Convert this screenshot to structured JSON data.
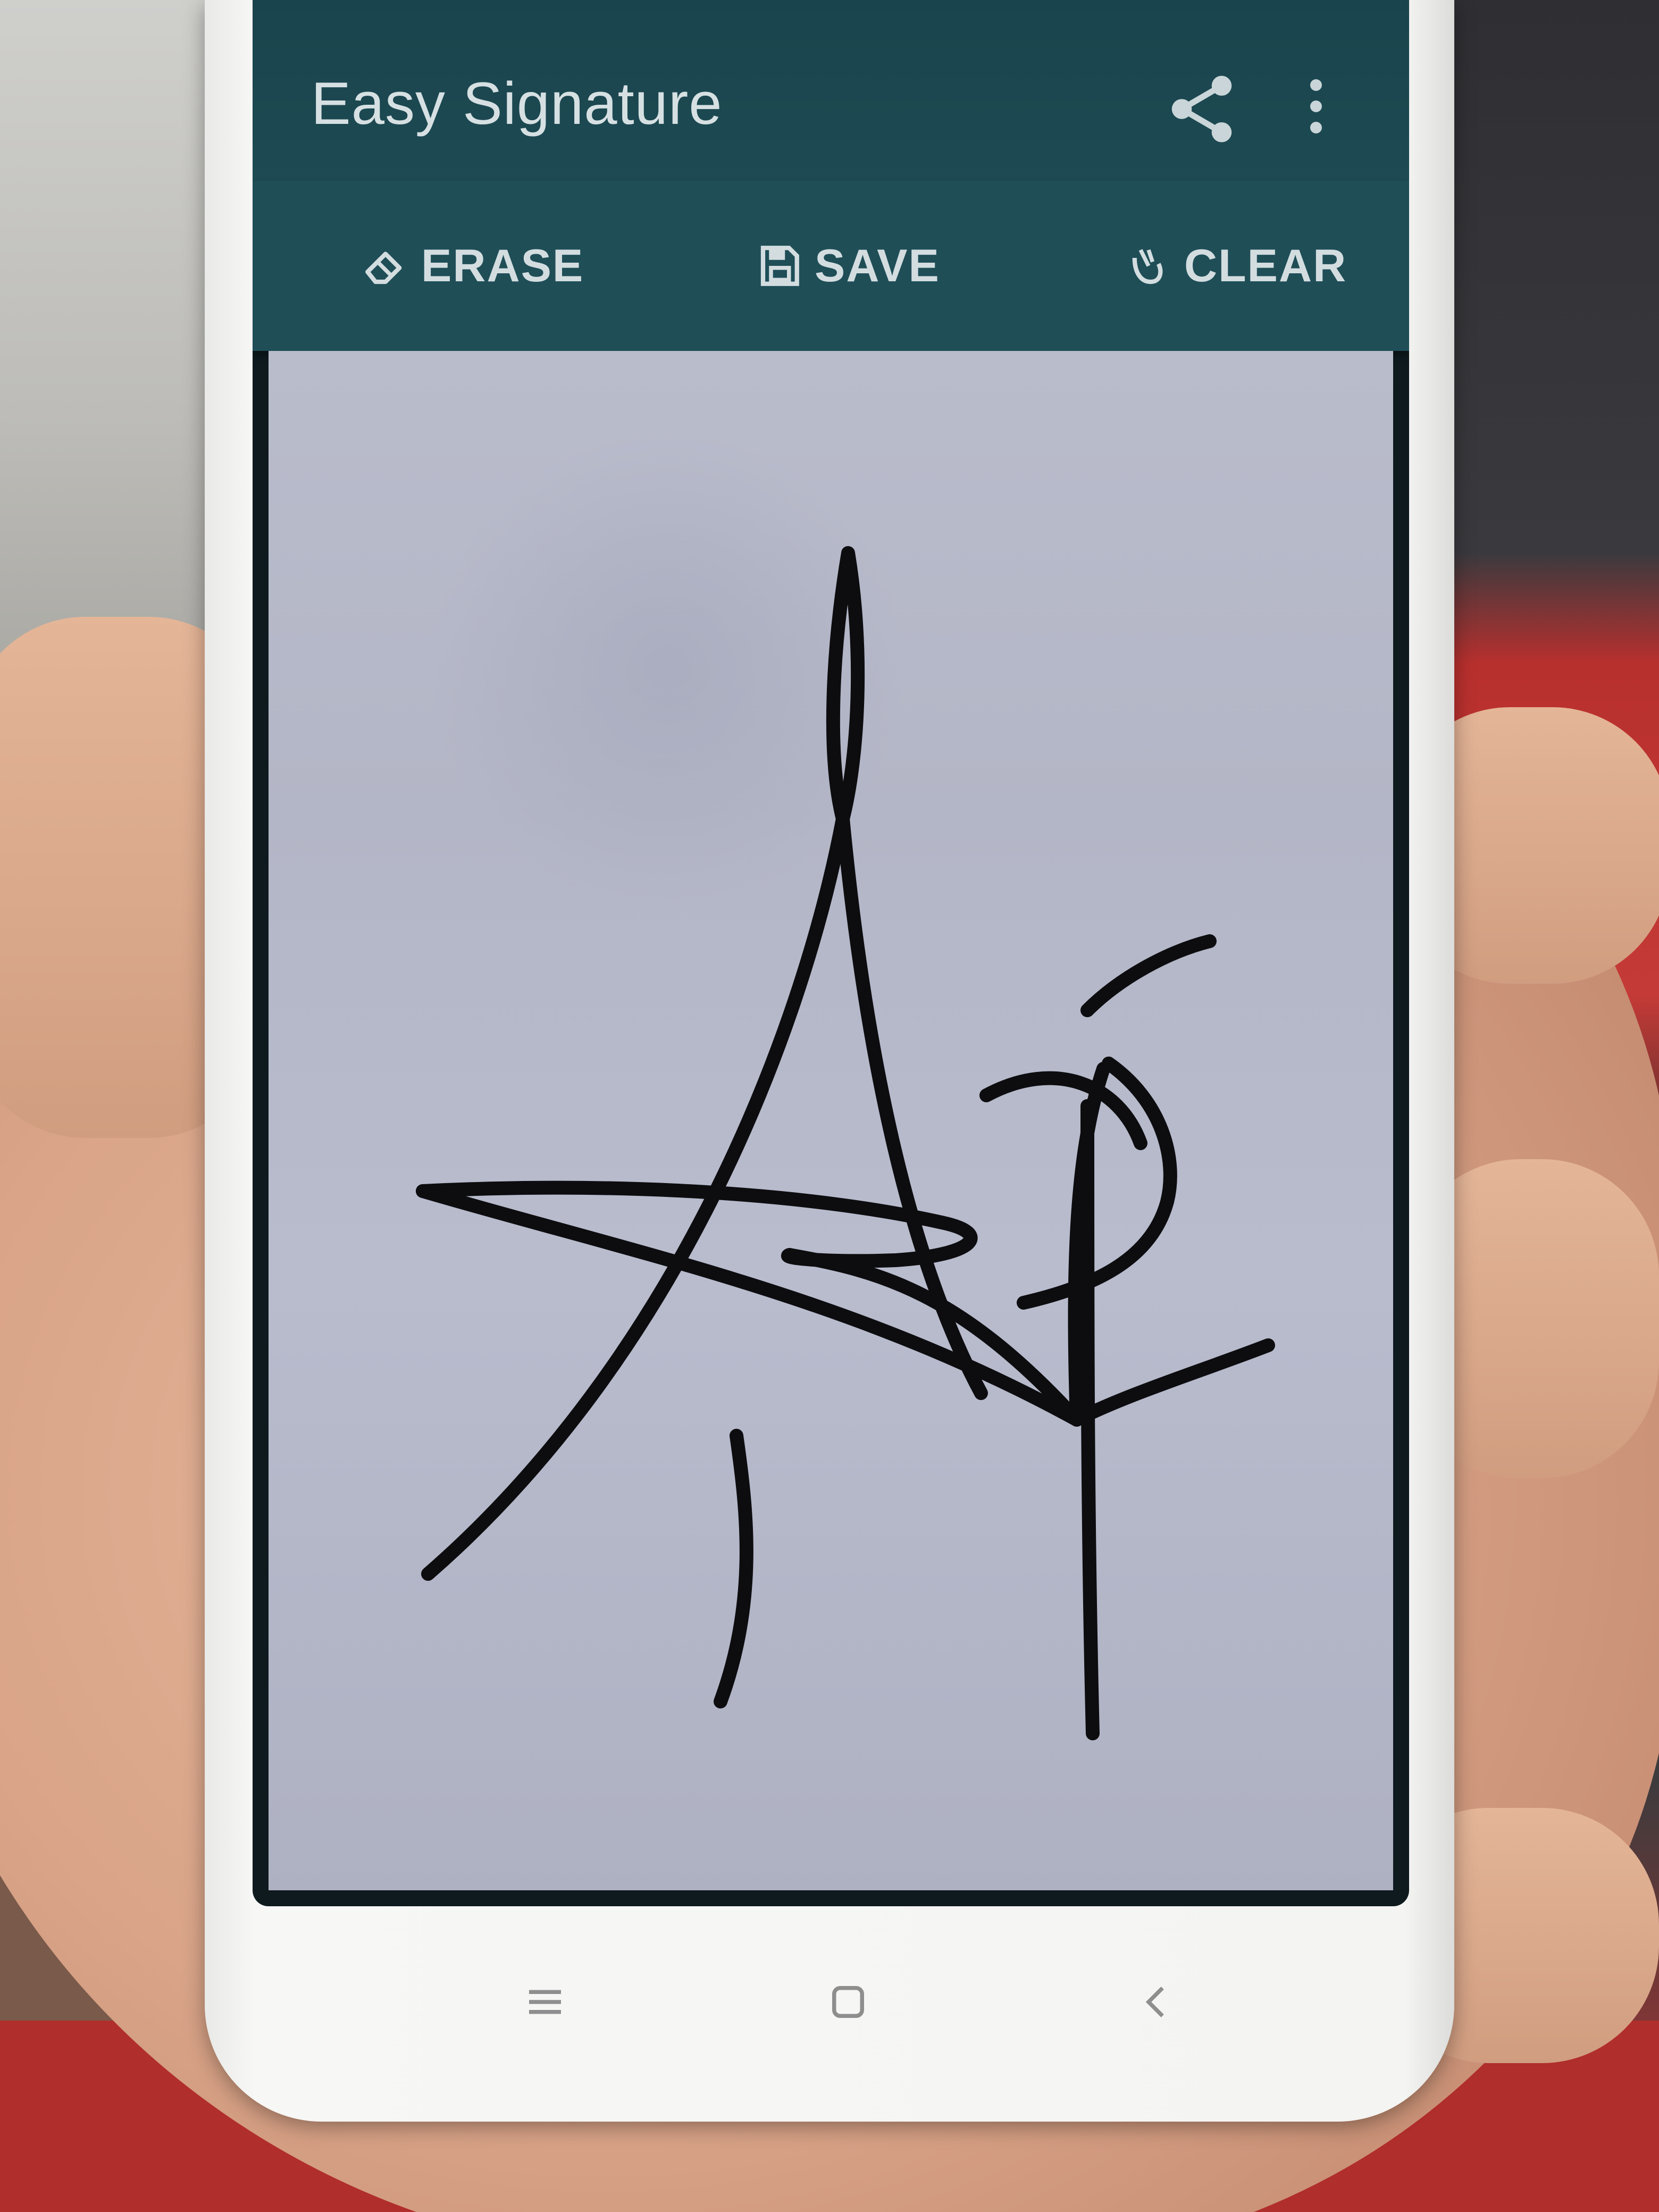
{
  "app": {
    "title": "Easy Signature"
  },
  "toolbar": {
    "erase_label": "ERASE",
    "save_label": "SAVE",
    "clear_label": "CLEAR"
  },
  "icons": {
    "share": "share-icon",
    "more": "more-vert-icon",
    "erase": "eraser-icon",
    "save": "floppy-disk-icon",
    "clear": "clear-broom-icon",
    "nav_menu": "hamburger-menu-icon",
    "nav_home": "square-home-icon",
    "nav_back": "chevron-left-icon"
  },
  "colors": {
    "appbar": "#1d4a53",
    "toolbar": "#1f4e57",
    "canvas": "#b6b9c9",
    "ink": "#0d0d10",
    "bar_text": "#d3dde0"
  }
}
